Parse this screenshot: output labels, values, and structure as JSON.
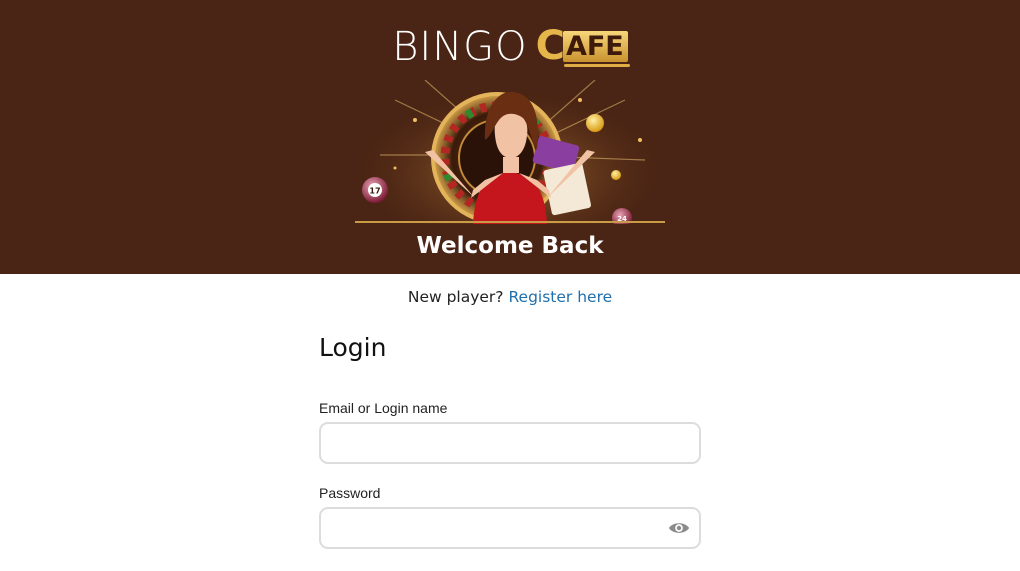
{
  "brand": {
    "word1": "BINGO",
    "word2_initial": "C",
    "word2_rest": "AFE"
  },
  "hero": {
    "heading": "Welcome Back",
    "ball_numbers": [
      "17",
      "24"
    ]
  },
  "register": {
    "prompt": "New player?",
    "link_label": "Register here"
  },
  "login": {
    "title": "Login",
    "email_label": "Email or Login name",
    "email_value": "",
    "password_label": "Password",
    "password_value": ""
  },
  "icons": {
    "password_toggle": "eye-icon"
  },
  "colors": {
    "hero_bg": "#4a2414",
    "gold": "#e0ad45",
    "link": "#1f6fad"
  }
}
